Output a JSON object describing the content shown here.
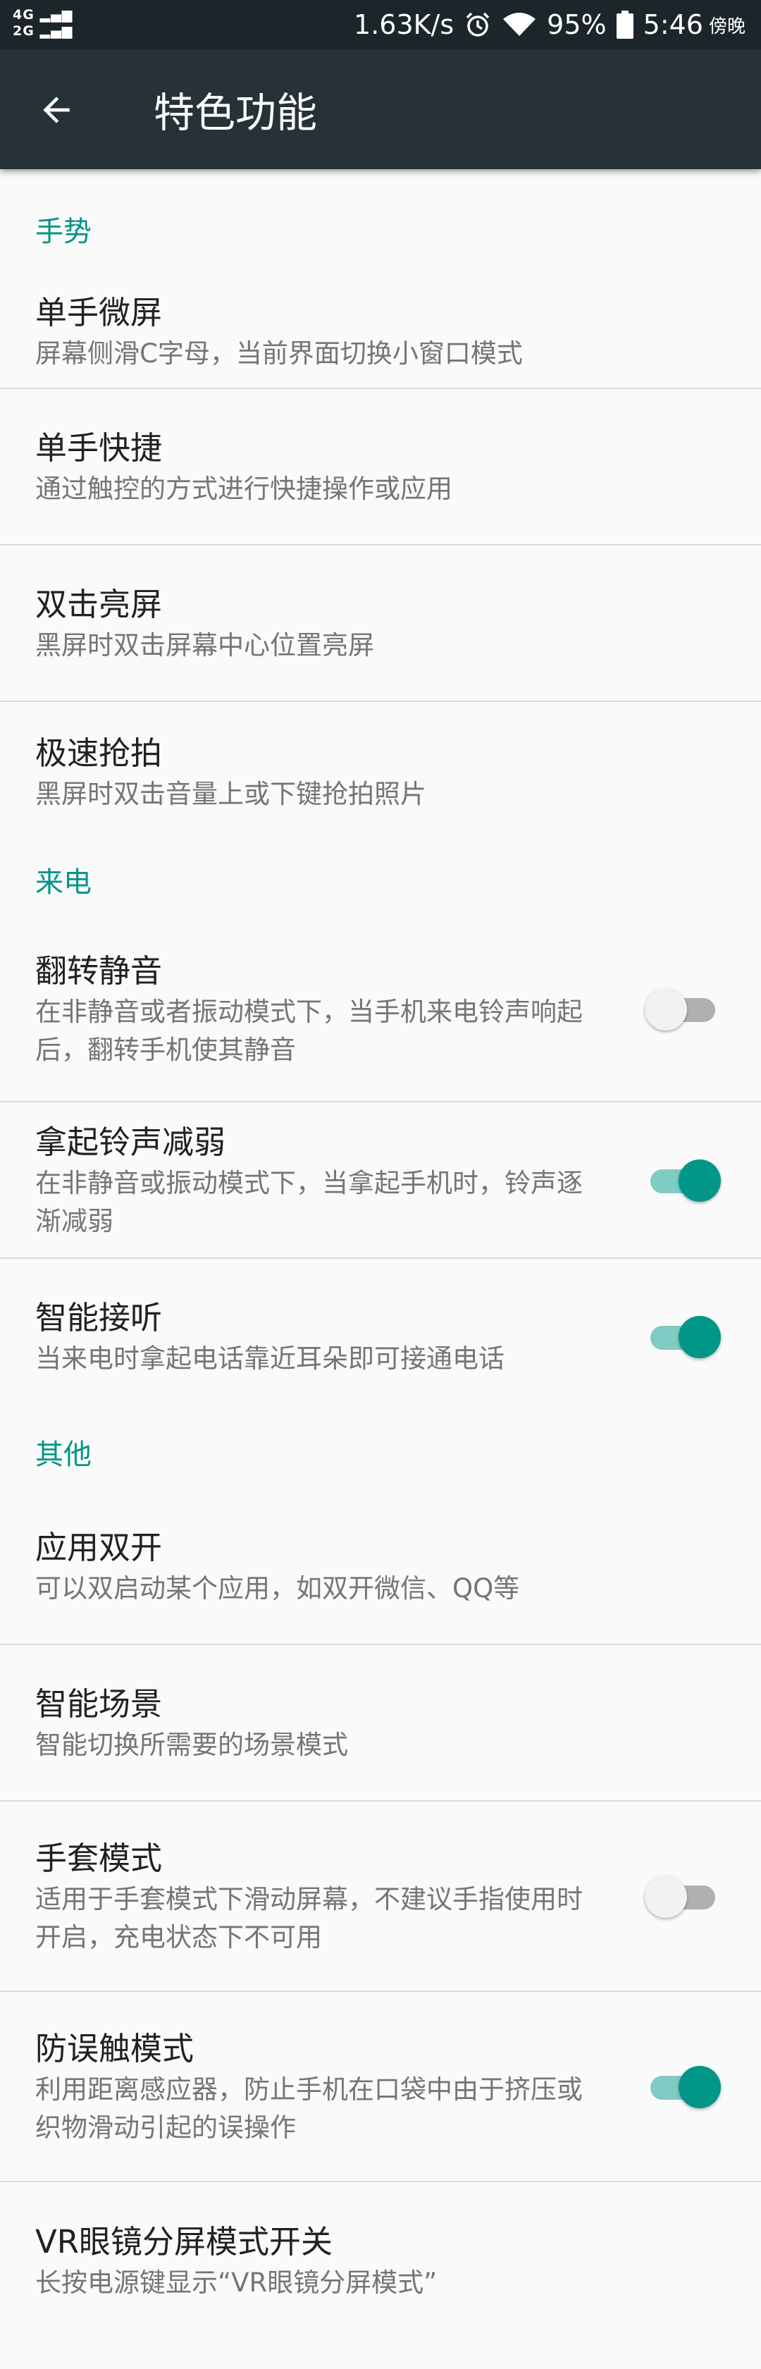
{
  "status_bar": {
    "network_top": "4G",
    "network_bottom": "2G",
    "speed": "1.63K/s",
    "battery": "95%",
    "time": "5:46",
    "period": "傍晚"
  },
  "app_bar": {
    "title": "特色功能"
  },
  "sections": {
    "gesture": {
      "header": "手势",
      "items": [
        {
          "title": "单手微屏",
          "sub": "屏幕侧滑C字母，当前界面切换小窗口模式"
        },
        {
          "title": "单手快捷",
          "sub": "通过触控的方式进行快捷操作或应用"
        },
        {
          "title": "双击亮屏",
          "sub": "黑屏时双击屏幕中心位置亮屏"
        },
        {
          "title": "极速抢拍",
          "sub": "黑屏时双击音量上或下键抢拍照片"
        }
      ]
    },
    "call": {
      "header": "来电",
      "items": [
        {
          "title": "翻转静音",
          "sub": "在非静音或者振动模式下，当手机来电铃声响起后，翻转手机使其静音",
          "enabled": false
        },
        {
          "title": "拿起铃声减弱",
          "sub": "在非静音或振动模式下，当拿起手机时，铃声逐渐减弱",
          "enabled": true
        },
        {
          "title": "智能接听",
          "sub": "当来电时拿起电话靠近耳朵即可接通电话",
          "enabled": true
        }
      ]
    },
    "other": {
      "header": "其他",
      "items": [
        {
          "title": "应用双开",
          "sub": "可以双启动某个应用，如双开微信、QQ等"
        },
        {
          "title": "智能场景",
          "sub": "智能切换所需要的场景模式"
        },
        {
          "title": "手套模式",
          "sub": "适用于手套模式下滑动屏幕，不建议手指使用时开启，充电状态下不可用",
          "enabled": false
        },
        {
          "title": "防误触模式",
          "sub": "利用距离感应器，防止手机在口袋中由于挤压或织物滑动引起的误操作",
          "enabled": true
        },
        {
          "title": "VR眼镜分屏模式开关",
          "sub": "长按电源键显示“VR眼镜分屏模式”"
        }
      ]
    }
  },
  "colors": {
    "accent": "#009688",
    "app_bar": "#263238",
    "status_bar": "#1c262a"
  }
}
